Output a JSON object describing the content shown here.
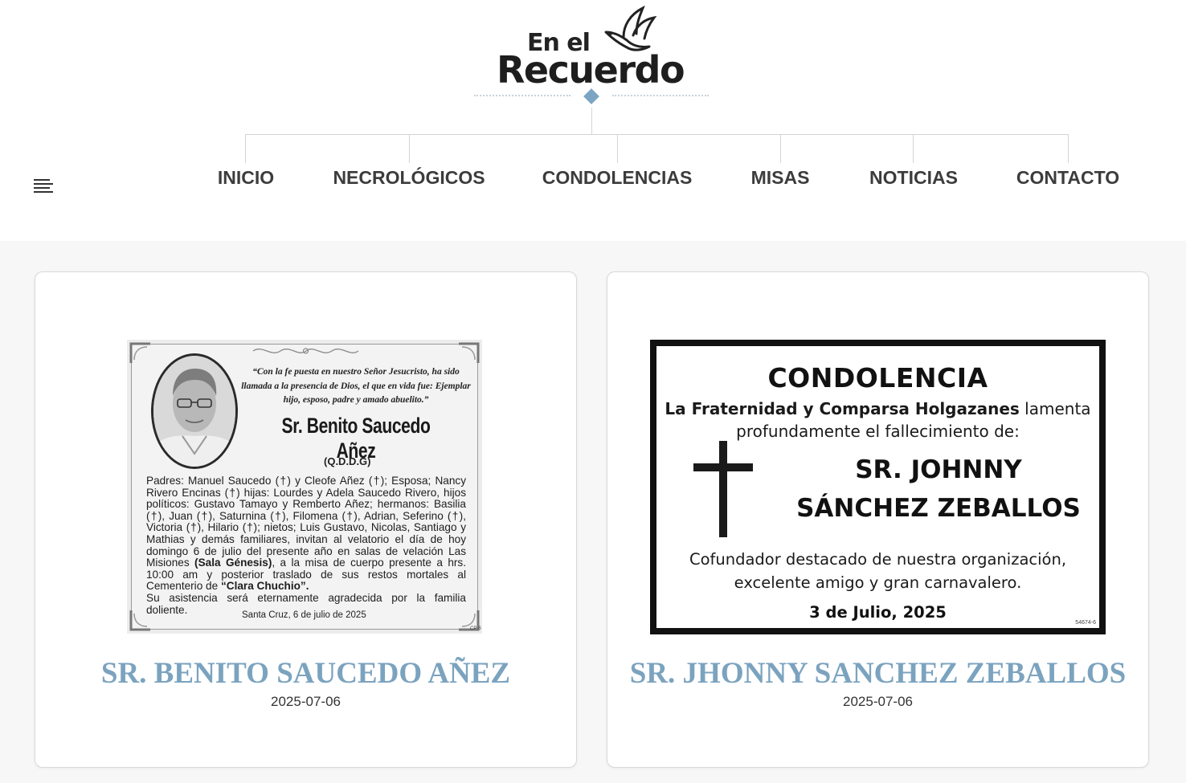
{
  "logo": {
    "line1": "En el",
    "line2": "Recuerdo",
    "accent": "#7ba5c3"
  },
  "nav": {
    "items": [
      {
        "label": "INICIO"
      },
      {
        "label": "NECROLÓGICOS"
      },
      {
        "label": "CONDOLENCIAS"
      },
      {
        "label": "MISAS"
      },
      {
        "label": "NOTICIAS"
      },
      {
        "label": "CONTACTO"
      }
    ],
    "menu_icon": "hamburger-menu-icon"
  },
  "cards": [
    {
      "title": "SR. BENITO SAUCEDO AÑEZ",
      "date": "2025-07-06",
      "notice": {
        "quote": "“Con la fe puesta en nuestro Señor Jesucristo, ha sido llamada a la presencia de Dios, el que en vida fue: Ejemplar hijo, esposo, padre y amado abuelito.”",
        "name": "Sr. Benito Saucedo Añez",
        "qddg": "(Q.D.D.G)",
        "body_part1": "Padres: Manuel Saucedo (†) y Cleofe Añez (†); Esposa; Nancy Rivero Encinas (†) hijas: Lourdes y Adela Saucedo Rivero, hijos políticos: Gustavo Tamayo y Remberto Añez; hermanos: Basilia (†), Juan (†), Saturnina (†), Filomena (†), Adrian, Seferino (†), Victoria (†), Hilario (†); nietos; Luis Gustavo, Nicolas, Santiago y Mathias y demás familiares, invitan al velatorio el día de hoy domingo 6 de julio del presente año en salas de velación Las Misiones ",
        "body_bold1": "(Sala Génesis)",
        "body_part2": ", a la misa de cuerpo presente a hrs. 10:00 am y posterior traslado de sus restos mortales al Cementerio de ",
        "body_bold2": "“Clara Chuchio”.",
        "body_part3": "Su asistencia será eternamente agradecida por la familia doliente.",
        "place_date": "Santa Cruz, 6 de julio de 2025",
        "code": "CP-6"
      }
    },
    {
      "title": "SR. JHONNY SANCHEZ ZEBALLOS",
      "date": "2025-07-06",
      "notice": {
        "heading": "CONDOLENCIA",
        "org": "La Fraternidad y Comparsa Holgazanes",
        "intro_rest": " lamenta",
        "intro_line2": "profundamente el fallecimiento de:",
        "deceased_line1": "SR. JOHNNY",
        "deceased_line2": "SÁNCHEZ ZEBALLOS",
        "desc_line1": "Cofundador destacado de nuestra organización,",
        "desc_line2": "excelente amigo y gran carnavalero.",
        "date": "3 de Julio, 2025",
        "code": "54674-6"
      }
    }
  ]
}
